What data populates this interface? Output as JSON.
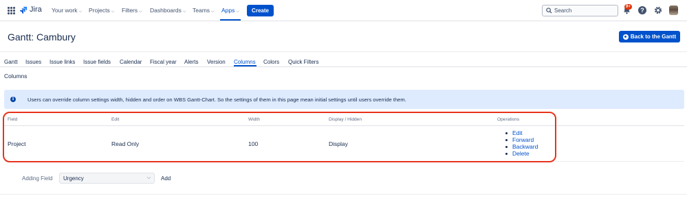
{
  "app": {
    "logo": "Jira"
  },
  "nav": {
    "items": [
      {
        "label": "Your work"
      },
      {
        "label": "Projects"
      },
      {
        "label": "Filters"
      },
      {
        "label": "Dashboards"
      },
      {
        "label": "Teams"
      },
      {
        "label": "Apps"
      }
    ],
    "create_label": "Create",
    "search_placeholder": "Search",
    "notifications_badge": "9+",
    "help_label": "?",
    "accent": "#0052cc"
  },
  "header": {
    "title": "Gantt: Cambury",
    "back_label": "Back to the Gantt"
  },
  "tabs": [
    {
      "label": "Gantt"
    },
    {
      "label": "Issues"
    },
    {
      "label": "Issue links"
    },
    {
      "label": "Issue fields"
    },
    {
      "label": "Calendar"
    },
    {
      "label": "Fiscal year"
    },
    {
      "label": "Alerts"
    },
    {
      "label": "Version"
    },
    {
      "label": "Columns"
    },
    {
      "label": "Colors"
    },
    {
      "label": "Quick Filters"
    }
  ],
  "active_tab": "Columns",
  "section": {
    "title": "Columns"
  },
  "info": {
    "icon": "info-icon",
    "text": "Users can override column settings width, hidden and order on WBS Gantt-Chart. So the settings of them in this page mean initial settings until users override them."
  },
  "table": {
    "headers": [
      "Field",
      "Edit",
      "Width",
      "Display / Hidden",
      "Operations"
    ],
    "rows": [
      {
        "field": "Project",
        "edit": "Read Only",
        "width": "100",
        "display": "Display",
        "operations": [
          "Edit",
          "Forward",
          "Backward",
          "Delete"
        ]
      }
    ]
  },
  "add_field": {
    "label": "Adding Field",
    "selected": "Urgency",
    "add_label": "Add"
  },
  "highlight_color": "#e8331b"
}
